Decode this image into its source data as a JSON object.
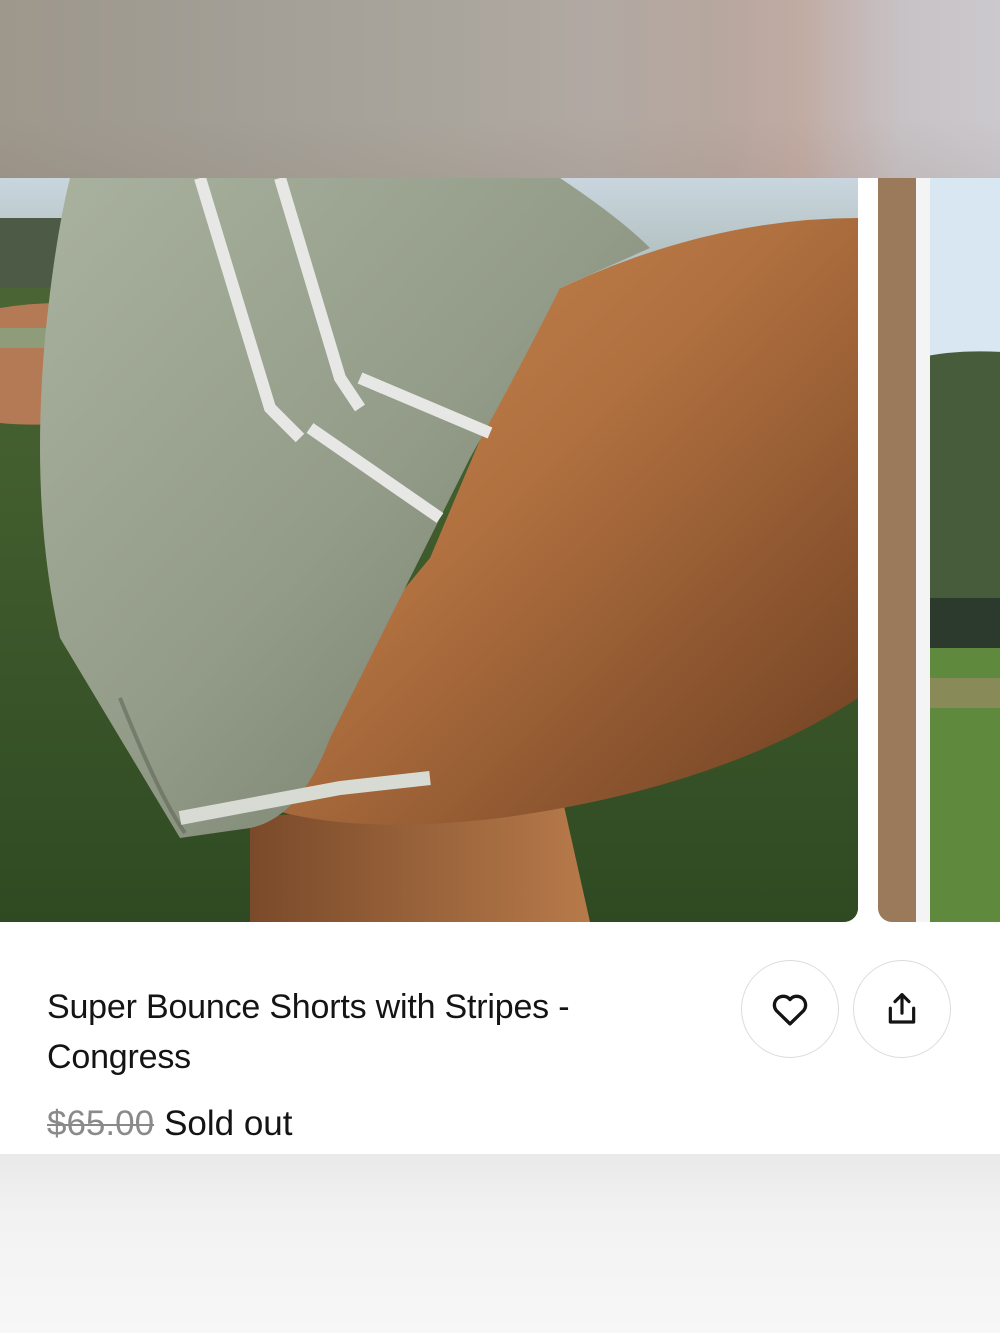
{
  "product": {
    "title": "Super Bounce Shorts with Stripes - Congress",
    "original_price": "$65.00",
    "status": "Sold out"
  },
  "actions": {
    "wishlist_icon": "heart-icon",
    "share_icon": "share-icon"
  },
  "colors": {
    "text": "#141414",
    "muted_price": "#8a8a8a",
    "button_border": "#dcdcdc"
  }
}
